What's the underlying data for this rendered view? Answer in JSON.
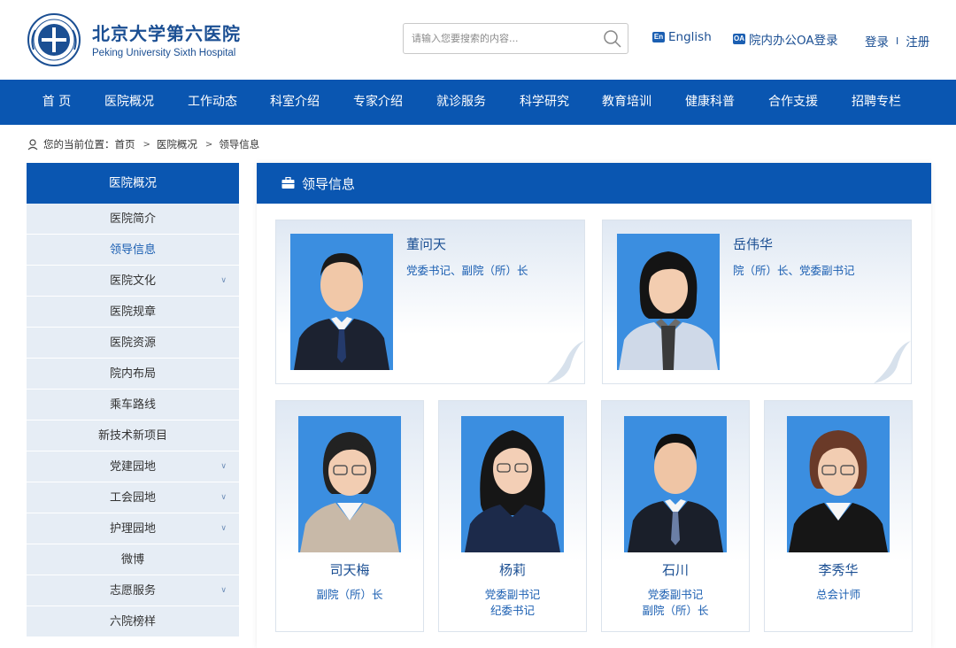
{
  "header": {
    "name_cn": "北京大学第六医院",
    "name_en": "Peking University Sixth Hospital",
    "search_placeholder": "请输入您要搜索的内容...",
    "english_badge": "En",
    "english_label": "English",
    "oa_badge": "OA",
    "oa_label": "院内办公OA登录",
    "login_label": "登录",
    "login_sep": "I",
    "register_label": "注册"
  },
  "nav": {
    "items": [
      "首 页",
      "医院概况",
      "工作动态",
      "科室介绍",
      "专家介绍",
      "就诊服务",
      "科学研究",
      "教育培训",
      "健康科普",
      "合作支援",
      "招聘专栏"
    ]
  },
  "breadcrumb": {
    "prefix": "您的当前位置：",
    "items": [
      "首页",
      "医院概况",
      "领导信息"
    ]
  },
  "sidebar": {
    "header": "医院概况",
    "items": [
      {
        "label": "医院简介",
        "arrow": false,
        "active": false
      },
      {
        "label": "领导信息",
        "arrow": false,
        "active": true
      },
      {
        "label": "医院文化",
        "arrow": true,
        "active": false
      },
      {
        "label": "医院规章",
        "arrow": false,
        "active": false
      },
      {
        "label": "医院资源",
        "arrow": false,
        "active": false
      },
      {
        "label": "院内布局",
        "arrow": false,
        "active": false
      },
      {
        "label": "乘车路线",
        "arrow": false,
        "active": false
      },
      {
        "label": "新技术新项目",
        "arrow": false,
        "active": false
      },
      {
        "label": "党建园地",
        "arrow": true,
        "active": false
      },
      {
        "label": "工会园地",
        "arrow": true,
        "active": false
      },
      {
        "label": "护理园地",
        "arrow": true,
        "active": false
      },
      {
        "label": "微博",
        "arrow": false,
        "active": false
      },
      {
        "label": "志愿服务",
        "arrow": true,
        "active": false
      },
      {
        "label": "六院榜样",
        "arrow": false,
        "active": false
      }
    ]
  },
  "main": {
    "title": "领导信息",
    "leaders_top": [
      {
        "name": "董问天",
        "title": "党委书记、副院（所）长"
      },
      {
        "name": "岳伟华",
        "title": "院（所）长、党委副书记"
      }
    ],
    "leaders_bottom": [
      {
        "name": "司天梅",
        "title_lines": [
          "副院（所）长"
        ]
      },
      {
        "name": "杨莉",
        "title_lines": [
          "党委副书记",
          "纪委书记"
        ]
      },
      {
        "name": "石川",
        "title_lines": [
          "党委副书记",
          "副院（所）长"
        ]
      },
      {
        "name": "李秀华",
        "title_lines": [
          "总会计师"
        ]
      }
    ]
  },
  "colors": {
    "primary_blue": "#0a56b1",
    "text_blue": "#1b4f93",
    "sidebar_bg": "#e6edf5",
    "photo_bg": "#3b8ee0"
  }
}
